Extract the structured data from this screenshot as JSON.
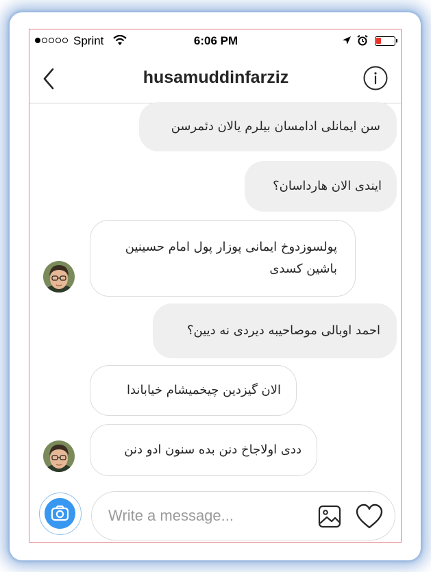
{
  "status_bar": {
    "carrier": "Sprint",
    "time": "6:06 PM",
    "signal_bars": 1,
    "battery_color": "#e8352c"
  },
  "header": {
    "title": "husamuddinfarziz",
    "back_icon": "chevron-left-icon",
    "info_icon": "info-icon"
  },
  "messages": [
    {
      "direction": "sent",
      "text": "سن ایمانلی ادامسان بیلرم یالان دئمرسن"
    },
    {
      "direction": "sent",
      "text": "ایندی الان هارداسان؟"
    },
    {
      "direction": "received",
      "text": "پولسوزدوخ ایمانی پوزار پول امام حسینین باشین کسدی"
    },
    {
      "direction": "sent",
      "text": "احمد اوبالی موصاحیبه دیردی نه دیین؟"
    },
    {
      "direction": "received",
      "text": "الان گیزدین چیخمیشام خیاباندا"
    },
    {
      "direction": "received",
      "text": "ددی اولاجاخ دنن بده سنون ادو دنن"
    }
  ],
  "composer": {
    "placeholder": "Write a message...",
    "camera_icon": "camera-icon",
    "gallery_icon": "image-icon",
    "like_icon": "heart-icon"
  },
  "colors": {
    "accent": "#3897f0",
    "sent_bubble": "#efefef",
    "received_border": "#dbdbdb",
    "frame_glow": "#5c8ccd",
    "frame_border": "#e57a84"
  }
}
